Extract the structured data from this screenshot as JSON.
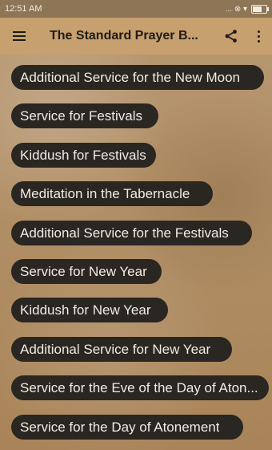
{
  "status_bar": {
    "time": "12:51 AM",
    "signals": "... ⊗ ▾",
    "battery_level": 0.6
  },
  "app_bar": {
    "title": "The Standard Prayer B..."
  },
  "services": [
    "Additional Service for the New Moon",
    "Service for Festivals",
    "Kiddush for Festivals",
    "Meditation in the Tabernacle",
    "Additional Service for the Festivals",
    "Service for New Year",
    "Kiddush for New Year",
    "Additional Service for New Year",
    "Service for the Eve of the Day of Aton...",
    "Service for the Day of Atonement"
  ]
}
